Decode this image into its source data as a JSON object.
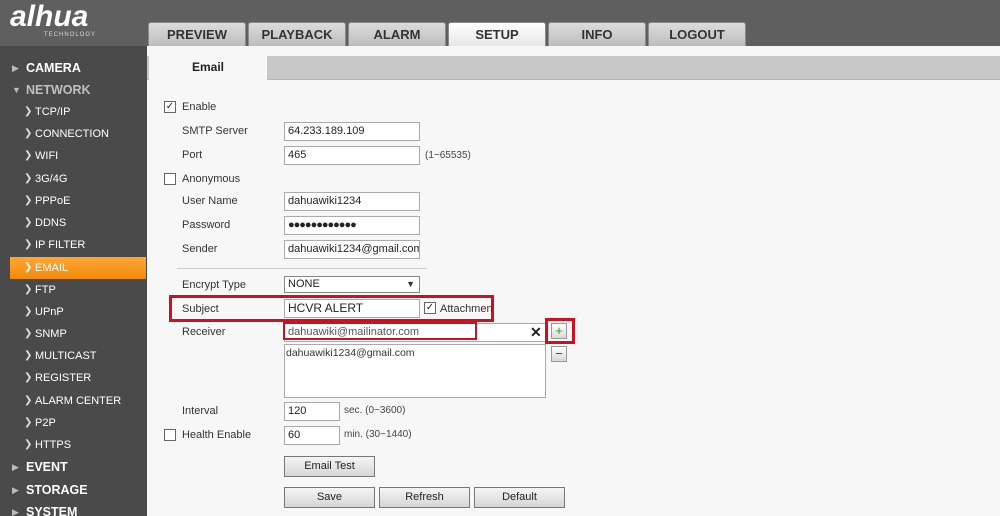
{
  "brand": {
    "logo_text": "alhua",
    "logo_subtext": "TECHNOLOGY"
  },
  "topnav": [
    "PREVIEW",
    "PLAYBACK",
    "ALARM",
    "SETUP",
    "INFO",
    "LOGOUT"
  ],
  "sidebar": {
    "camera": "CAMERA",
    "network": "NETWORK",
    "items": [
      "TCP/IP",
      "CONNECTION",
      "WIFI",
      "3G/4G",
      "PPPoE",
      "DDNS",
      "IP FILTER",
      "EMAIL",
      "FTP",
      "UPnP",
      "SNMP",
      "MULTICAST",
      "REGISTER",
      "ALARM CENTER",
      "P2P",
      "HTTPS"
    ],
    "event": "EVENT",
    "storage": "STORAGE",
    "system": "SYSTEM"
  },
  "page": {
    "tab": "Email"
  },
  "form": {
    "enable_label": "Enable",
    "smtp_label": "SMTP Server",
    "smtp_value": "64.233.189.109",
    "port_label": "Port",
    "port_value": "465",
    "port_hint": "(1~65535)",
    "anonymous_label": "Anonymous",
    "username_label": "User Name",
    "username_value": "dahuawiki1234",
    "password_label": "Password",
    "password_value": "●●●●●●●●●●●●",
    "sender_label": "Sender",
    "sender_value": "dahuawiki1234@gmail.com",
    "encrypt_label": "Encrypt Type",
    "encrypt_value": "NONE",
    "subject_label": "Subject",
    "subject_value": "HCVR ALERT",
    "attachment_label": "Attachmen",
    "receiver_label": "Receiver",
    "receiver_value": "dahuawiki@mailinator.com",
    "receiver_list": [
      "dahuawiki1234@gmail.com"
    ],
    "interval_label": "Interval",
    "interval_value": "120",
    "interval_hint": "sec. (0~3600)",
    "health_label": "Health Enable",
    "health_value": "60",
    "health_hint": "min. (30~1440)",
    "email_test": "Email Test",
    "save": "Save",
    "refresh": "Refresh",
    "default": "Default",
    "check_mark": "✓",
    "add_glyph": "+",
    "remove_glyph": "−",
    "clear_glyph": "✕"
  },
  "colors": {
    "accent_orange": "#f59a23",
    "highlight_red": "#d0101e"
  },
  "icons": {
    "expand": "triangle-right-icon",
    "collapse": "triangle-down-icon",
    "subitem": "chevron-right-icon"
  }
}
